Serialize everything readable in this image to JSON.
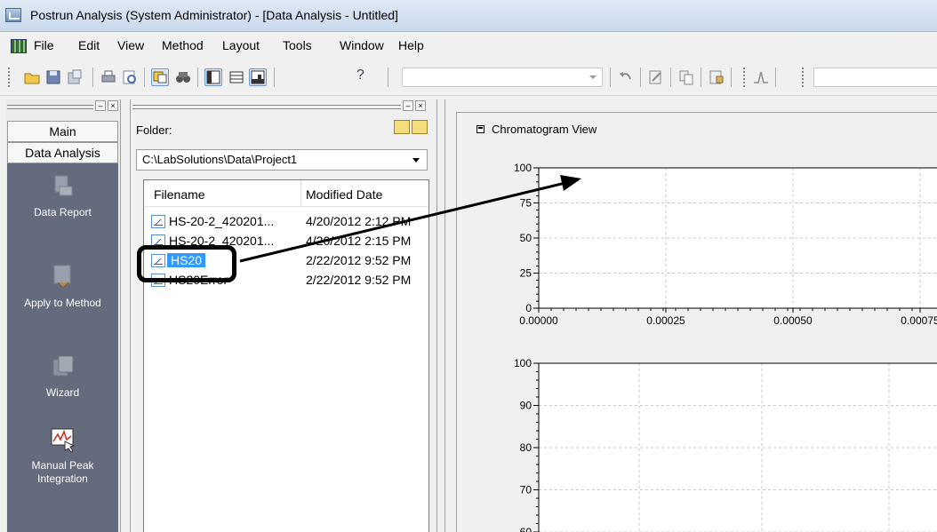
{
  "window": {
    "title": "Postrun Analysis (System Administrator) - [Data Analysis - Untitled]"
  },
  "menu": {
    "items": [
      "File",
      "Edit",
      "View",
      "Method",
      "Layout",
      "Tools",
      "Window",
      "Help"
    ]
  },
  "toolbar": {
    "help_glyph": "?",
    "combo_value": ""
  },
  "nav": {
    "tabs": [
      "Main",
      "Data Analysis"
    ],
    "items": [
      {
        "label": "Data Report",
        "icon": "data-report-icon"
      },
      {
        "label": "Apply to Method",
        "icon": "apply-to-method-icon"
      },
      {
        "label": "Wizard",
        "icon": "wizard-icon"
      },
      {
        "label": "Manual Peak Integration",
        "icon": "manual-peak-integration-icon"
      }
    ]
  },
  "file_pane": {
    "folder_label": "Folder:",
    "folder_path": "C:\\LabSolutions\\Data\\Project1",
    "columns": [
      "Filename",
      "Modified Date"
    ],
    "files": [
      {
        "name": "HS-20-2_420201...",
        "date": "4/20/2012 2:12 PM",
        "selected": false
      },
      {
        "name": "HS-20-2_420201...",
        "date": "4/20/2012 2:15 PM",
        "selected": false
      },
      {
        "name": "HS20",
        "date": "2/22/2012 9:52 PM",
        "selected": true
      },
      {
        "name": "HS20Error",
        "date": "2/22/2012 9:52 PM",
        "selected": false
      }
    ]
  },
  "chromatogram": {
    "title": "Chromatogram View"
  },
  "chart_data": [
    {
      "type": "line",
      "title": "",
      "xlabel": "",
      "ylabel": "",
      "x_ticks": [
        "0.00000",
        "0.00025",
        "0.00050",
        "0.00075"
      ],
      "y_ticks": [
        "100",
        "75",
        "50",
        "25",
        "0"
      ],
      "xlim": [
        0,
        0.00075
      ],
      "ylim": [
        0,
        100
      ],
      "grid": true,
      "series": []
    },
    {
      "type": "line",
      "title": "",
      "xlabel": "",
      "ylabel": "",
      "y_ticks": [
        "100",
        "90",
        "80",
        "70",
        "60"
      ],
      "ylim": [
        60,
        100
      ],
      "grid": true,
      "series": []
    }
  ]
}
